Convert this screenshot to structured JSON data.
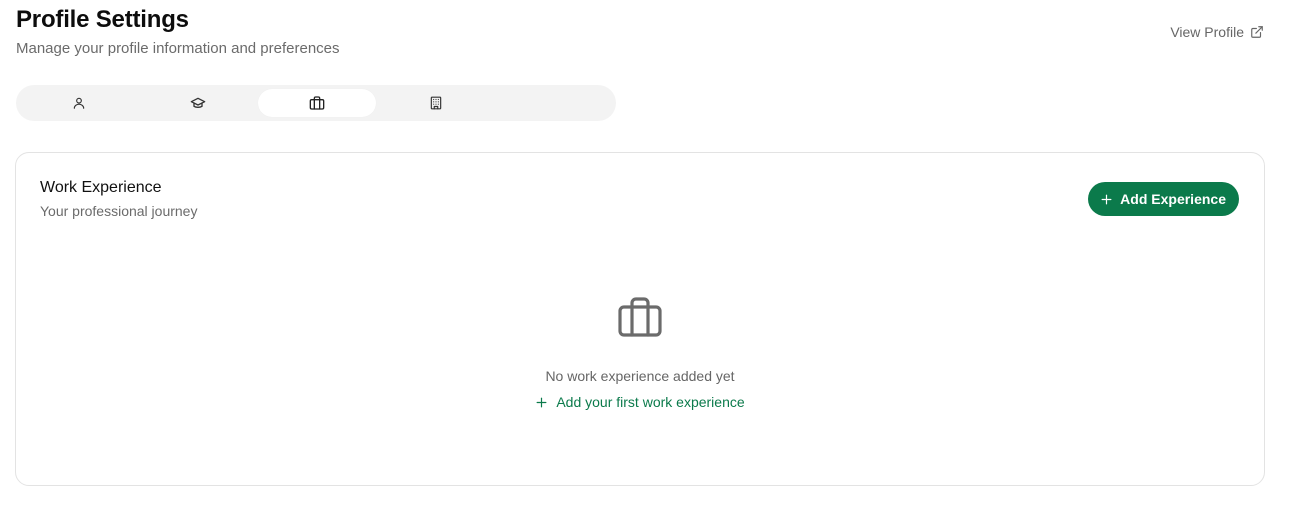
{
  "header": {
    "title": "Profile Settings",
    "subtitle": "Manage your profile information and preferences",
    "view_profile_label": "View Profile",
    "view_profile_icon": "external-link-icon"
  },
  "tabs": [
    {
      "icon": "user-icon",
      "active": false
    },
    {
      "icon": "graduation-cap-icon",
      "active": false
    },
    {
      "icon": "briefcase-icon",
      "active": true
    },
    {
      "icon": "building-icon",
      "active": false
    }
  ],
  "section": {
    "title": "Work Experience",
    "subtitle": "Your professional journey",
    "add_button_label": "Add Experience",
    "add_button_icon": "plus-icon",
    "empty_icon": "briefcase-icon",
    "empty_text": "No work experience added yet",
    "empty_link_label": "Add your first work experience"
  },
  "colors": {
    "accent": "#0b7a4b",
    "muted_text": "#6b6b6b",
    "tab_bg": "#f3f3f3"
  }
}
